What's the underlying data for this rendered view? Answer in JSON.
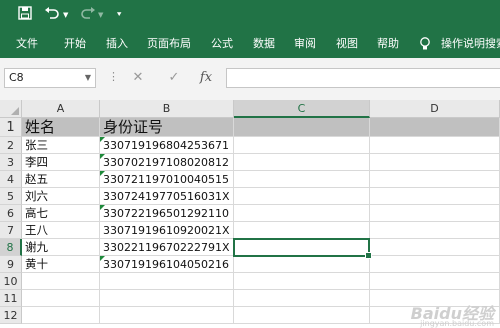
{
  "quick_access": {
    "save_icon": "save-icon",
    "undo_icon": "undo-icon",
    "redo_icon": "redo-icon",
    "customize_icon": "customize-icon"
  },
  "ribbon": {
    "tabs": [
      "文件",
      "开始",
      "插入",
      "页面布局",
      "公式",
      "数据",
      "审阅",
      "视图",
      "帮助"
    ],
    "tell_me": "操作说明搜索"
  },
  "formula_bar": {
    "name_box": "C8",
    "cancel": "✕",
    "enter": "✓",
    "fx": "fx",
    "formula": ""
  },
  "sheet": {
    "columns": [
      "A",
      "B",
      "C",
      "D"
    ],
    "rows": [
      "1",
      "2",
      "3",
      "4",
      "5",
      "6",
      "7",
      "8",
      "9",
      "10",
      "11",
      "12"
    ],
    "header": {
      "name": "姓名",
      "id": "身份证号"
    },
    "records": [
      {
        "name": "张三",
        "id": "330719196804253671"
      },
      {
        "name": "李四",
        "id": "330702197108020812"
      },
      {
        "name": "赵五",
        "id": "330721197010040515"
      },
      {
        "name": "刘六",
        "id": "33072419770516031X"
      },
      {
        "name": "高七",
        "id": "330722196501292110"
      },
      {
        "name": "王八",
        "id": "33071919610920021X"
      },
      {
        "name": "谢九",
        "id": "33022119670222791X"
      },
      {
        "name": "黄十",
        "id": "330719196104050216"
      }
    ],
    "selected_cell": "C8"
  },
  "watermark": {
    "text": "Baidu经验",
    "sub": "jingyan.baidu.com"
  }
}
